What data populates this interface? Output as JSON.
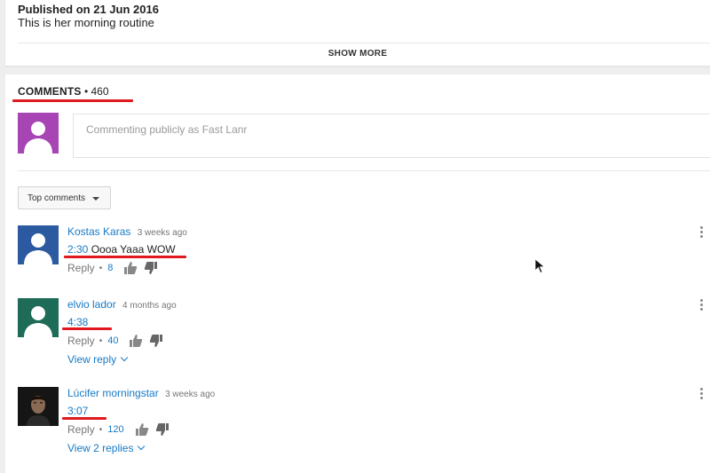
{
  "video_description": {
    "published": "Published on 21 Jun 2016",
    "text": "This is her morning routine",
    "show_more": "SHOW MORE"
  },
  "comments_section": {
    "title": "COMMENTS",
    "separator": "•",
    "count": "460",
    "input_placeholder": "Commenting publicly as Fast Lanr",
    "sort_label": "Top comments"
  },
  "comments": [
    {
      "author": "Kostas Karas",
      "time": "3 weeks ago",
      "timestamp": "2:30",
      "text": "Oooa Yaaa WOW",
      "reply_label": "Reply",
      "dot": "•",
      "likes": "8",
      "view_replies": ""
    },
    {
      "author": "elvio lador",
      "time": "4 months ago",
      "timestamp": "4:38",
      "text": "",
      "reply_label": "Reply",
      "dot": "•",
      "likes": "40",
      "view_replies": "View reply"
    },
    {
      "author": "Lúcifer morningstar",
      "time": "3 weeks ago",
      "timestamp": "3:07",
      "text": "",
      "reply_label": "Reply",
      "dot": "•",
      "likes": "120",
      "view_replies": "View 2 replies"
    }
  ],
  "colors": {
    "link_blue": "#167ac6",
    "annotation_red": "#e0191f",
    "my_avatar": "#a845b5",
    "avatar_blue": "#2c5aa0",
    "avatar_green": "#1e6b57"
  }
}
